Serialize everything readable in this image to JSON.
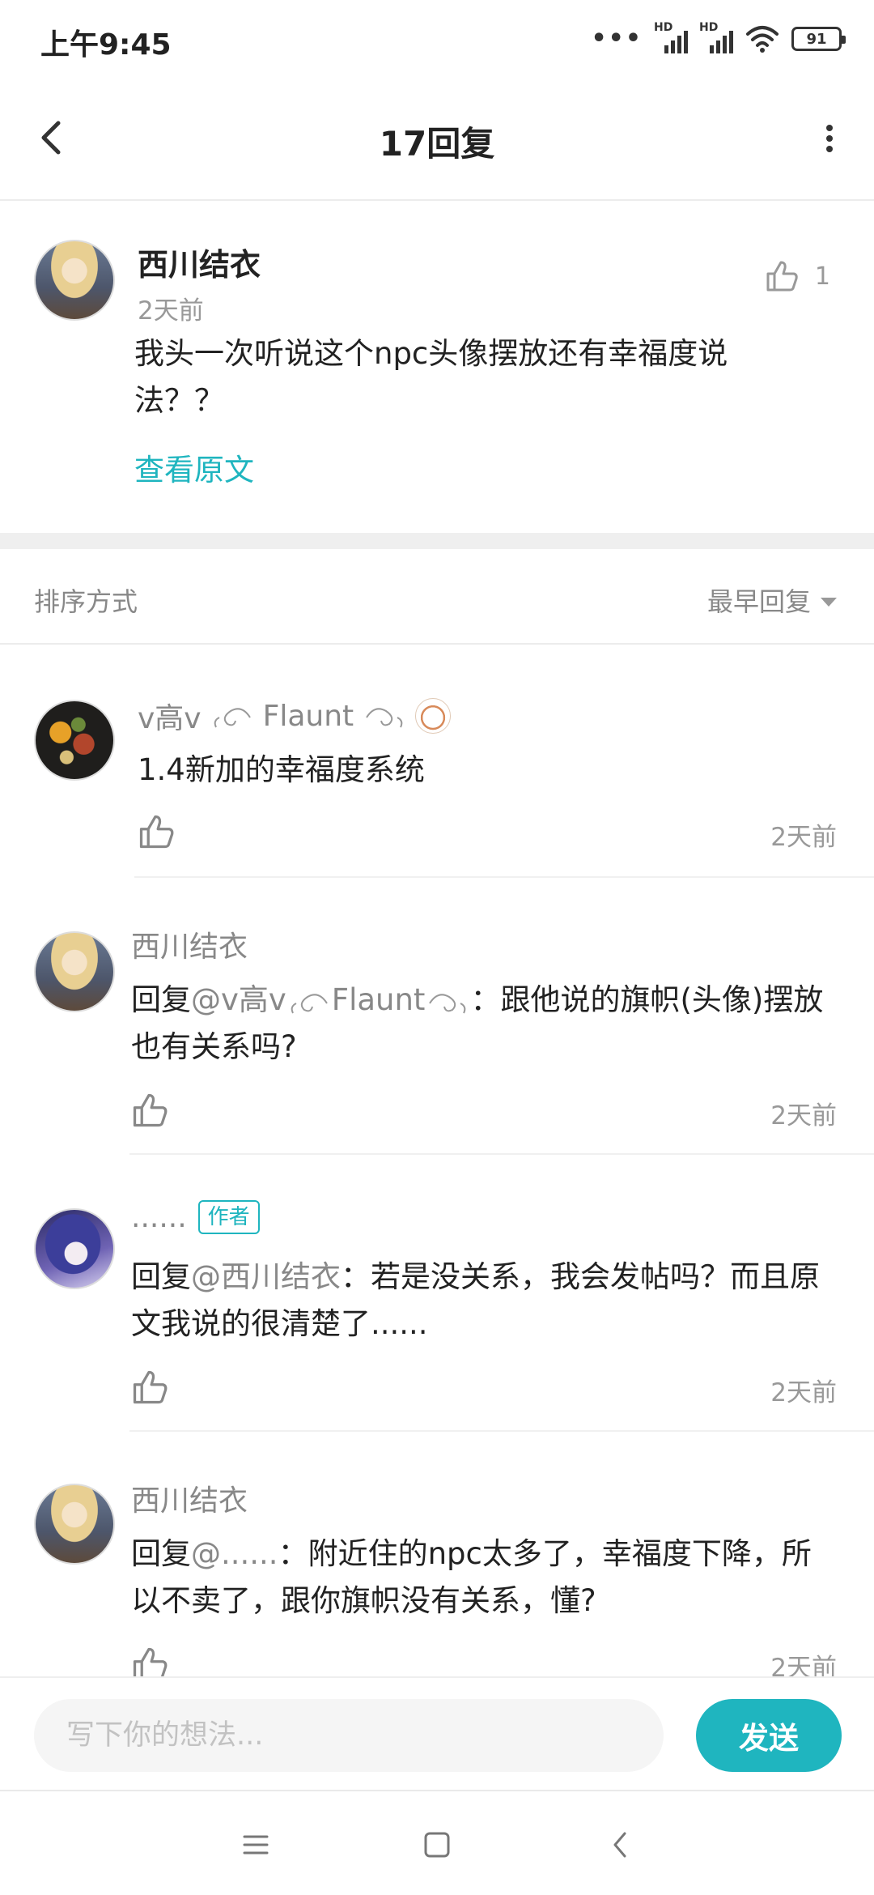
{
  "status_bar": {
    "time": "上午9:45",
    "dots": "•••",
    "signal_1_label": "HD",
    "signal_2_label": "HD",
    "battery": "91"
  },
  "header": {
    "title": "17回复"
  },
  "post": {
    "author": "西川结衣",
    "time": "2天前",
    "like_count": "1",
    "content": "我头一次听说这个npc头像摆放还有幸福度说法？？",
    "view_original": "查看原文"
  },
  "sort": {
    "label": "排序方式",
    "value": "最早回复"
  },
  "replies": [
    {
      "author": "v高v",
      "author_suffix": "Flaunt",
      "text": "1.4新加的幸福度系统",
      "time": "2天前"
    },
    {
      "author": "西川结衣",
      "reply_prefix": "回复",
      "mention": "@v高v",
      "mention_suffix": "Flaunt",
      "text": "：跟他说的旗帜(头像)摆放也有关系吗?",
      "time": "2天前"
    },
    {
      "author": "......",
      "badge": "作者",
      "reply_prefix": "回复",
      "mention": "@西川结衣",
      "text": "：若是没关系，我会发帖吗？而且原文我说的很清楚了......",
      "time": "2天前"
    },
    {
      "author": "西川结衣",
      "reply_prefix": "回复",
      "mention": "@......",
      "text": "：附近住的npc太多了，幸福度下降，所以不卖了，跟你旗帜没有关系，懂?",
      "time": "2天前"
    }
  ],
  "input": {
    "placeholder": "写下你的想法...",
    "send_label": "发送"
  },
  "icons": {
    "back": "chevron-left-icon",
    "more": "more-vertical-icon",
    "like": "thumbs-up-icon",
    "sort_caret": "caret-down-icon",
    "nav_menu": "menu-icon",
    "nav_home": "home-square-icon",
    "nav_back": "nav-back-icon"
  },
  "colors": {
    "accent": "#1fb5bf",
    "muted_text": "#888888",
    "primary_text": "#222222"
  }
}
